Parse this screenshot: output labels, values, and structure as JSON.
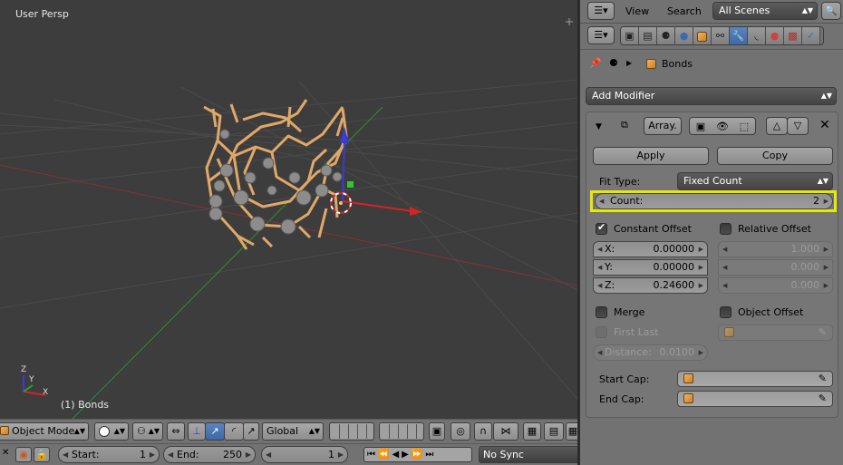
{
  "viewport": {
    "view_label": "User Persp",
    "object_label": "(1) Bonds",
    "axis_x": "X",
    "axis_y": "Y",
    "axis_z": "Z"
  },
  "viewport_header": {
    "mode": "Object Mode",
    "orientation": "Global"
  },
  "timeline": {
    "start_label": "Start:",
    "start_value": "1",
    "end_label": "End:",
    "end_value": "250",
    "current_frame": "1",
    "sync": "No Sync"
  },
  "outliner_header": {
    "view_menu": "View",
    "search_menu": "Search",
    "scene_selector": "All Scenes"
  },
  "properties": {
    "breadcrumb_object": "Bonds",
    "add_modifier": "Add Modifier",
    "modifier_name": "Array.",
    "apply_button": "Apply",
    "copy_button": "Copy",
    "fit_type_label": "Fit Type:",
    "fit_type_value": "Fixed Count",
    "count_label": "Count:",
    "count_value": "2",
    "constant_offset_label": "Constant Offset",
    "relative_offset_label": "Relative Offset",
    "constant": {
      "x_label": "X:",
      "x_value": "0.00000",
      "y_label": "Y:",
      "y_value": "0.00000",
      "z_label": "Z:",
      "z_value": "0.24600"
    },
    "relative": {
      "x_value": "1.000",
      "y_value": "0.000",
      "z_value": "0.000"
    },
    "merge_label": "Merge",
    "object_offset_label": "Object Offset",
    "first_last_label": "First Last",
    "distance_label": "Distance:",
    "distance_value": "0.0100",
    "start_cap_label": "Start Cap:",
    "end_cap_label": "End Cap:"
  },
  "colors": {
    "highlight": "#e8e800",
    "bond": "#e8b070",
    "atom": "#8a8a8a",
    "x_axis": "#cc2222",
    "y_axis": "#3aa23a",
    "z_axis": "#3b3bd6"
  }
}
